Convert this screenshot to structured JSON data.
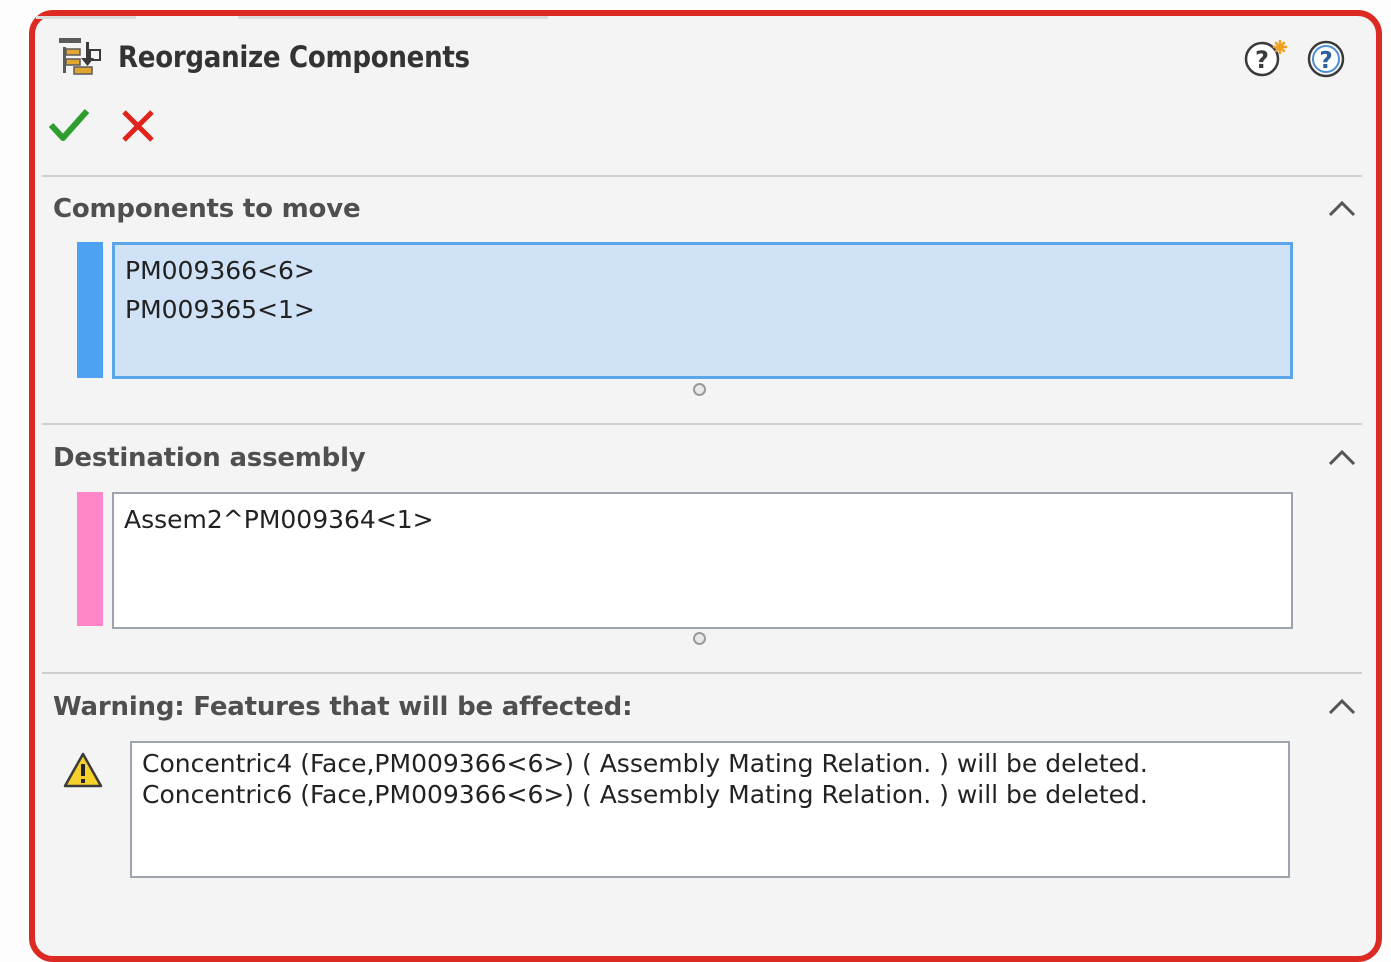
{
  "title": "Reorganize Components",
  "icons": {
    "title": "reorganize-components-icon",
    "whats_new_help": "whats-new-help-icon",
    "help": "help-icon",
    "ok": "check-icon",
    "cancel": "close-icon",
    "warning": "warning-icon",
    "collapse": "chevron-up-icon"
  },
  "colors": {
    "frame_highlight": "#dc2a22",
    "components_bar": "#4ea2f2",
    "destination_bar": "#ff86c8",
    "ok_green": "#2f9e2f",
    "cancel_red": "#e0241b",
    "selected_list_bg": "#cfe2f6"
  },
  "sections": {
    "components": {
      "title": "Components to move",
      "items": [
        "PM009366<6>",
        "PM009365<1>"
      ]
    },
    "destination": {
      "title": "Destination assembly",
      "items": [
        "Assem2^PM009364<1>"
      ]
    },
    "warning": {
      "title": "Warning: Features that will be affected:",
      "items": [
        "Concentric4 (Face,PM009366<6>) ( Assembly Mating Relation. )  will be deleted.",
        "Concentric6 (Face,PM009366<6>) ( Assembly Mating Relation. )  will be deleted."
      ]
    }
  }
}
